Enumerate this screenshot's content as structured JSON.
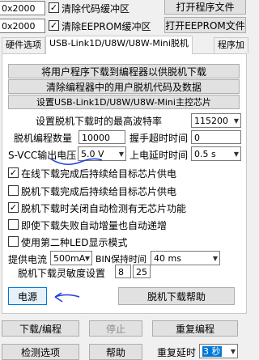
{
  "top": {
    "baud1": "0x2000",
    "baud2": "0x2000",
    "clear_code_buffer": "清除代码缓冲区",
    "clear_eeprom_buffer": "清除EEPROM缓冲区",
    "open_program_file": "打开程序文件",
    "open_eeprom_file": "打开EEPROM文件"
  },
  "tabs": [
    "硬件选项",
    "USB-Link1D/U8W/U8W-Mini脱机",
    "程序加"
  ],
  "panel": {
    "btn_download_user_program": "将用户程序下载到编程器以供脱机下载",
    "btn_clear_user_code": "清除编程器中的用户脱机代码及数据",
    "btn_set_master_chip": "设置USB-Link1D/U8W/U8W-Mini主控芯片",
    "max_baud_label": "设置脱机下载时的最高波特率",
    "max_baud_value": "115200",
    "prog_count_label": "脱机编程数量",
    "prog_count_value": "10000",
    "handshake_timeout_label": "握手超时时间",
    "handshake_timeout_value": "0",
    "svcc_label": "S-VCC输出电压",
    "svcc_value": "5.0 V",
    "power_delay_label": "上电延时时间",
    "power_delay_value": "0.5 s",
    "checks": [
      {
        "label": "在线下载完成后持续给目标芯片供电",
        "checked": true
      },
      {
        "label": "脱机下载完成后持续给目标芯片供电",
        "checked": false
      },
      {
        "label": "脱机下载时关闭自动检测有无芯片功能",
        "checked": true
      },
      {
        "label": "即使下载失败自动增量也自动递增",
        "checked": false
      },
      {
        "label": "使用第二种LED显示模式",
        "checked": false
      }
    ],
    "supply_current_label": "提供电流",
    "supply_current_value": "500mA",
    "bin_hold_label": "BIN保持时间",
    "bin_hold_value": "40 ms",
    "sensitivity_label": "脱机下载灵敏度设置",
    "sensitivity_a": "8",
    "sensitivity_b": "25",
    "btn_power": "电源",
    "btn_offline_help": "脱机下载帮助"
  },
  "bottom": {
    "btn_download": "下载/编程",
    "btn_stop": "停止",
    "btn_reprogram": "重复编程",
    "btn_detect": "检测选项",
    "btn_help": "帮助",
    "repeat_delay_label": "重复延时",
    "repeat_delay_value": "3 秒"
  },
  "colors": {
    "annotation": "#1f3fd8",
    "highlight": "#0078d7",
    "disabled_text": "#8a8a8a"
  }
}
